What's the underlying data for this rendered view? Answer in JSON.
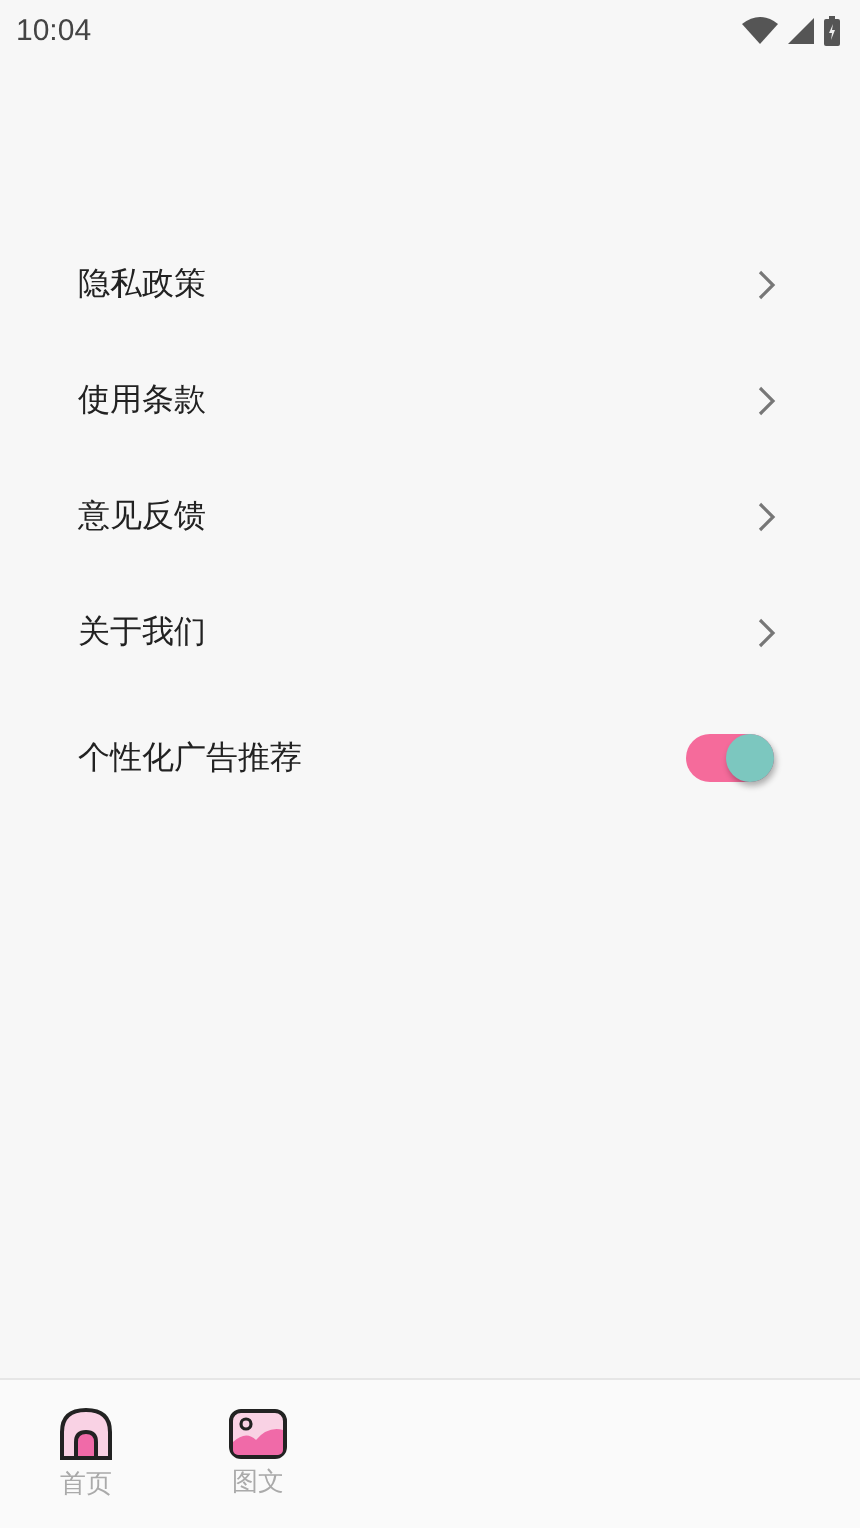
{
  "status_bar": {
    "time": "10:04"
  },
  "settings": [
    {
      "kind": "link",
      "label": "隐私政策"
    },
    {
      "kind": "link",
      "label": "使用条款"
    },
    {
      "kind": "link",
      "label": "意见反馈"
    },
    {
      "kind": "link",
      "label": "关于我们"
    },
    {
      "kind": "toggle",
      "label": "个性化广告推荐",
      "on": true
    }
  ],
  "tab_bar": [
    {
      "kind": "home",
      "label": "首页"
    },
    {
      "kind": "gallery",
      "label": "图文"
    }
  ]
}
